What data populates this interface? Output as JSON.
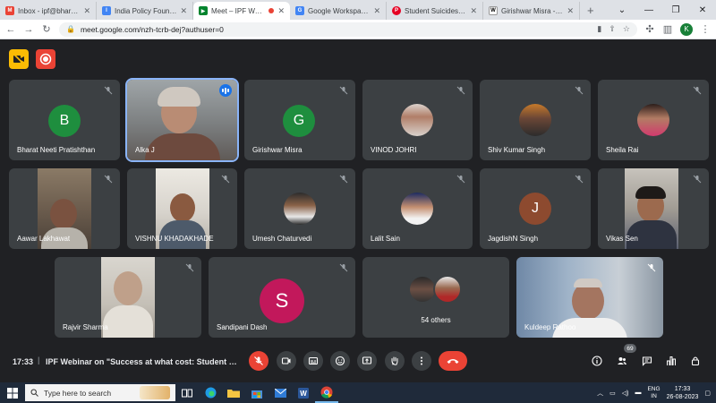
{
  "browser": {
    "tabs": [
      {
        "title": "Inbox - ipf@bharatneeti",
        "fav_color": "#ea4335",
        "fav_glyph": "M",
        "active": false
      },
      {
        "title": "India Policy Foundation",
        "fav_color": "#4285f4",
        "fav_glyph": "I",
        "active": false
      },
      {
        "title": "Meet – IPF Webinar",
        "fav_color": "#00832d",
        "fav_glyph": "▶",
        "active": true
      },
      {
        "title": "Google Workspace Help",
        "fav_color": "#4285f4",
        "fav_glyph": "G",
        "active": false
      },
      {
        "title": "Student Suicides: How",
        "fav_color": "#e60023",
        "fav_glyph": "P",
        "active": false
      },
      {
        "title": "Girishwar Misra - Wiki",
        "fav_color": "#ffffff",
        "fav_glyph": "W",
        "active": false
      }
    ],
    "new_tab": "+",
    "url": "meet.google.com/nzh-tcrb-dej?authuser=0",
    "profile_initial": "K"
  },
  "meet": {
    "participants": [
      {
        "name": "Bharat Neeti Pratishthan",
        "initial": "B",
        "color": "#1e8e3e"
      },
      {
        "name": "Alka J"
      },
      {
        "name": "Girishwar Misra",
        "initial": "G",
        "color": "#1e8e3e"
      },
      {
        "name": "VINOD JOHRI"
      },
      {
        "name": "Shiv Kumar Singh"
      },
      {
        "name": "Sheila Rai"
      },
      {
        "name": "Aawar Lakhawat"
      },
      {
        "name": "VISHNU KHADAKHADE"
      },
      {
        "name": "Umesh Chaturvedi"
      },
      {
        "name": "Lalit Sain"
      },
      {
        "name": "JagdishN Singh",
        "initial": "J",
        "color": "#8d4a2f"
      },
      {
        "name": "Vikas Sen"
      },
      {
        "name": "Rajvir Sharma"
      },
      {
        "name": "Sandipani Dash",
        "initial": "S",
        "color": "#c2185b"
      },
      {
        "name": "Kuldeep Rathoo"
      }
    ],
    "others_label": "54 others",
    "clock": "17:33",
    "separator": "|",
    "meeting_title": "IPF Webinar on \"Success at what cost: Student Suicides\"",
    "participant_count": "69"
  },
  "taskbar": {
    "search_placeholder": "Type here to search",
    "lang_top": "ENG",
    "lang_bottom": "IN",
    "time": "17:33",
    "date": "26-08-2023"
  },
  "colors": {
    "meet_bg": "#202124",
    "tile_bg": "#3c4043",
    "speaking_outline": "#8ab4f8",
    "end_call": "#ea4335"
  }
}
